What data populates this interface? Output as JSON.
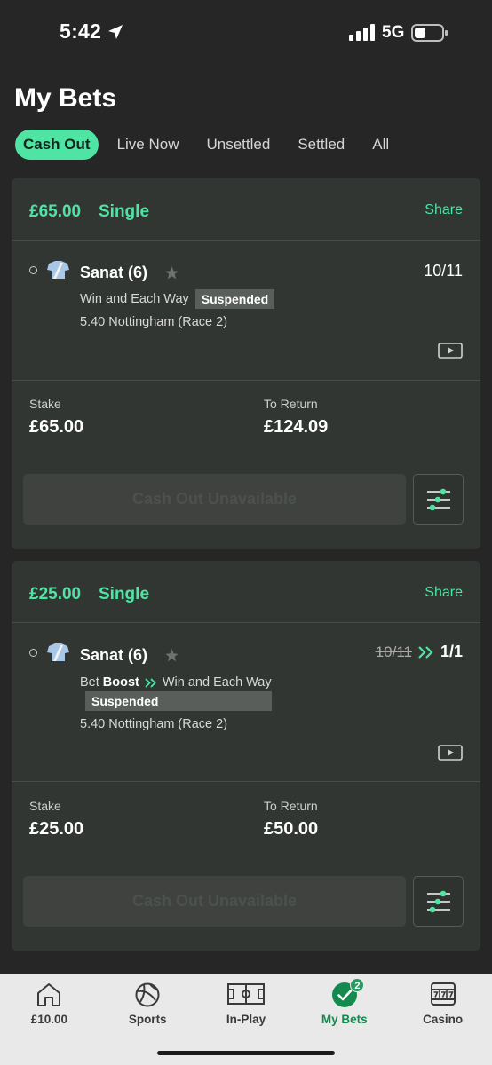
{
  "status_bar": {
    "time": "5:42",
    "network": "5G"
  },
  "page_title": "My Bets",
  "tabs": [
    {
      "label": "Cash Out",
      "active": true
    },
    {
      "label": "Live Now",
      "active": false
    },
    {
      "label": "Unsettled",
      "active": false
    },
    {
      "label": "Settled",
      "active": false
    },
    {
      "label": "All",
      "active": false
    }
  ],
  "bets": [
    {
      "amount": "£65.00",
      "type": "Single",
      "share": "Share",
      "runner": "Sanat (6)",
      "odds": "10/11",
      "market": "Win and Each Way",
      "status": "Suspended",
      "event": "5.40 Nottingham (Race 2)",
      "stake_label": "Stake",
      "stake": "£65.00",
      "return_label": "To Return",
      "return": "£124.09",
      "cashout": "Cash Out Unavailable"
    },
    {
      "amount": "£25.00",
      "type": "Single",
      "share": "Share",
      "runner": "Sanat (6)",
      "odds_old": "10/11",
      "odds": "1/1",
      "boost_prefix": "Bet",
      "boost_label": "Boost",
      "market": "Win and Each Way",
      "status": "Suspended",
      "event": "5.40 Nottingham (Race 2)",
      "stake_label": "Stake",
      "stake": "£25.00",
      "return_label": "To Return",
      "return": "£50.00",
      "cashout": "Cash Out Unavailable"
    }
  ],
  "nav": [
    {
      "label": "£10.00",
      "icon": "home-icon"
    },
    {
      "label": "Sports",
      "icon": "football-icon"
    },
    {
      "label": "In-Play",
      "icon": "pitch-icon"
    },
    {
      "label": "My Bets",
      "icon": "check-circle-icon",
      "badge": "2",
      "active": true
    },
    {
      "label": "Casino",
      "icon": "slot-machine-icon"
    }
  ],
  "colors": {
    "accent": "#4fe3a4",
    "background": "#252625",
    "card": "#323633",
    "nav_active": "#158a4f"
  }
}
